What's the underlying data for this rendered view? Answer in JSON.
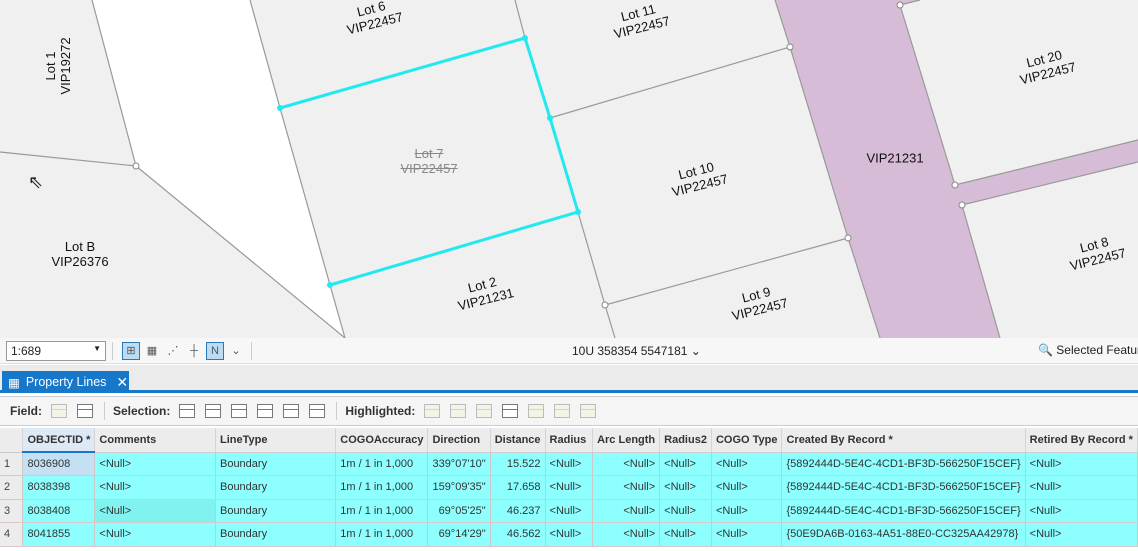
{
  "map": {
    "labels": [
      {
        "lot": "Lot 6",
        "id": "VIP22457"
      },
      {
        "lot": "Lot 11",
        "id": "VIP22457"
      },
      {
        "lot": "Lot 1",
        "id": "VIP19272"
      },
      {
        "lot": "Lot 20",
        "id": "VIP22457"
      },
      {
        "lot": "Lot 7",
        "id": "VIP22457"
      },
      {
        "lot": "Lot 10",
        "id": "VIP22457"
      },
      {
        "lot": "",
        "id": "VIP21231"
      },
      {
        "lot": "Lot B",
        "id": "VIP26376"
      },
      {
        "lot": "Lot 8",
        "id": "VIP22457"
      },
      {
        "lot": "Lot 2",
        "id": "VIP21231"
      },
      {
        "lot": "Lot 9",
        "id": "VIP22457"
      }
    ],
    "selection_color": "#22e8f0",
    "road_color": "#d6bcd6"
  },
  "status": {
    "scale": "1:689",
    "coordinates": "10U 358354 5547181",
    "selected_features": "Selected Featur"
  },
  "tab": {
    "title": "Property Lines"
  },
  "toolbar": {
    "field": "Field:",
    "selection": "Selection:",
    "highlighted": "Highlighted:"
  },
  "table": {
    "columns": [
      "OBJECTID *",
      "Comments",
      "LineType",
      "COGOAccuracy",
      "Direction",
      "Distance",
      "Radius",
      "Arc Length",
      "Radius2",
      "COGO Type",
      "Created By Record *",
      "Retired By Record *"
    ],
    "rows": [
      {
        "n": "1",
        "cells": [
          "8036908",
          "<Null>",
          "Boundary",
          "1m / 1 in 1,000",
          "339°07'10\"",
          "15.522",
          "<Null>",
          "<Null>",
          "<Null>",
          "<Null>",
          "{5892444D-5E4C-4CD1-BF3D-566250F15CEF}",
          "<Null>"
        ]
      },
      {
        "n": "2",
        "cells": [
          "8038398",
          "<Null>",
          "Boundary",
          "1m / 1 in 1,000",
          "159°09'35\"",
          "17.658",
          "<Null>",
          "<Null>",
          "<Null>",
          "<Null>",
          "{5892444D-5E4C-4CD1-BF3D-566250F15CEF}",
          "<Null>"
        ]
      },
      {
        "n": "3",
        "cells": [
          "8038408",
          "<Null>",
          "Boundary",
          "1m / 1 in 1,000",
          "69°05'25\"",
          "46.237",
          "<Null>",
          "<Null>",
          "<Null>",
          "<Null>",
          "{5892444D-5E4C-4CD1-BF3D-566250F15CEF}",
          "<Null>"
        ]
      },
      {
        "n": "4",
        "cells": [
          "8041855",
          "<Null>",
          "Boundary",
          "1m / 1 in 1,000",
          "69°14'29\"",
          "46.562",
          "<Null>",
          "<Null>",
          "<Null>",
          "<Null>",
          "{50E9DA6B-0163-4A51-88E0-CC325AA42978}",
          "<Null>"
        ]
      }
    ]
  }
}
